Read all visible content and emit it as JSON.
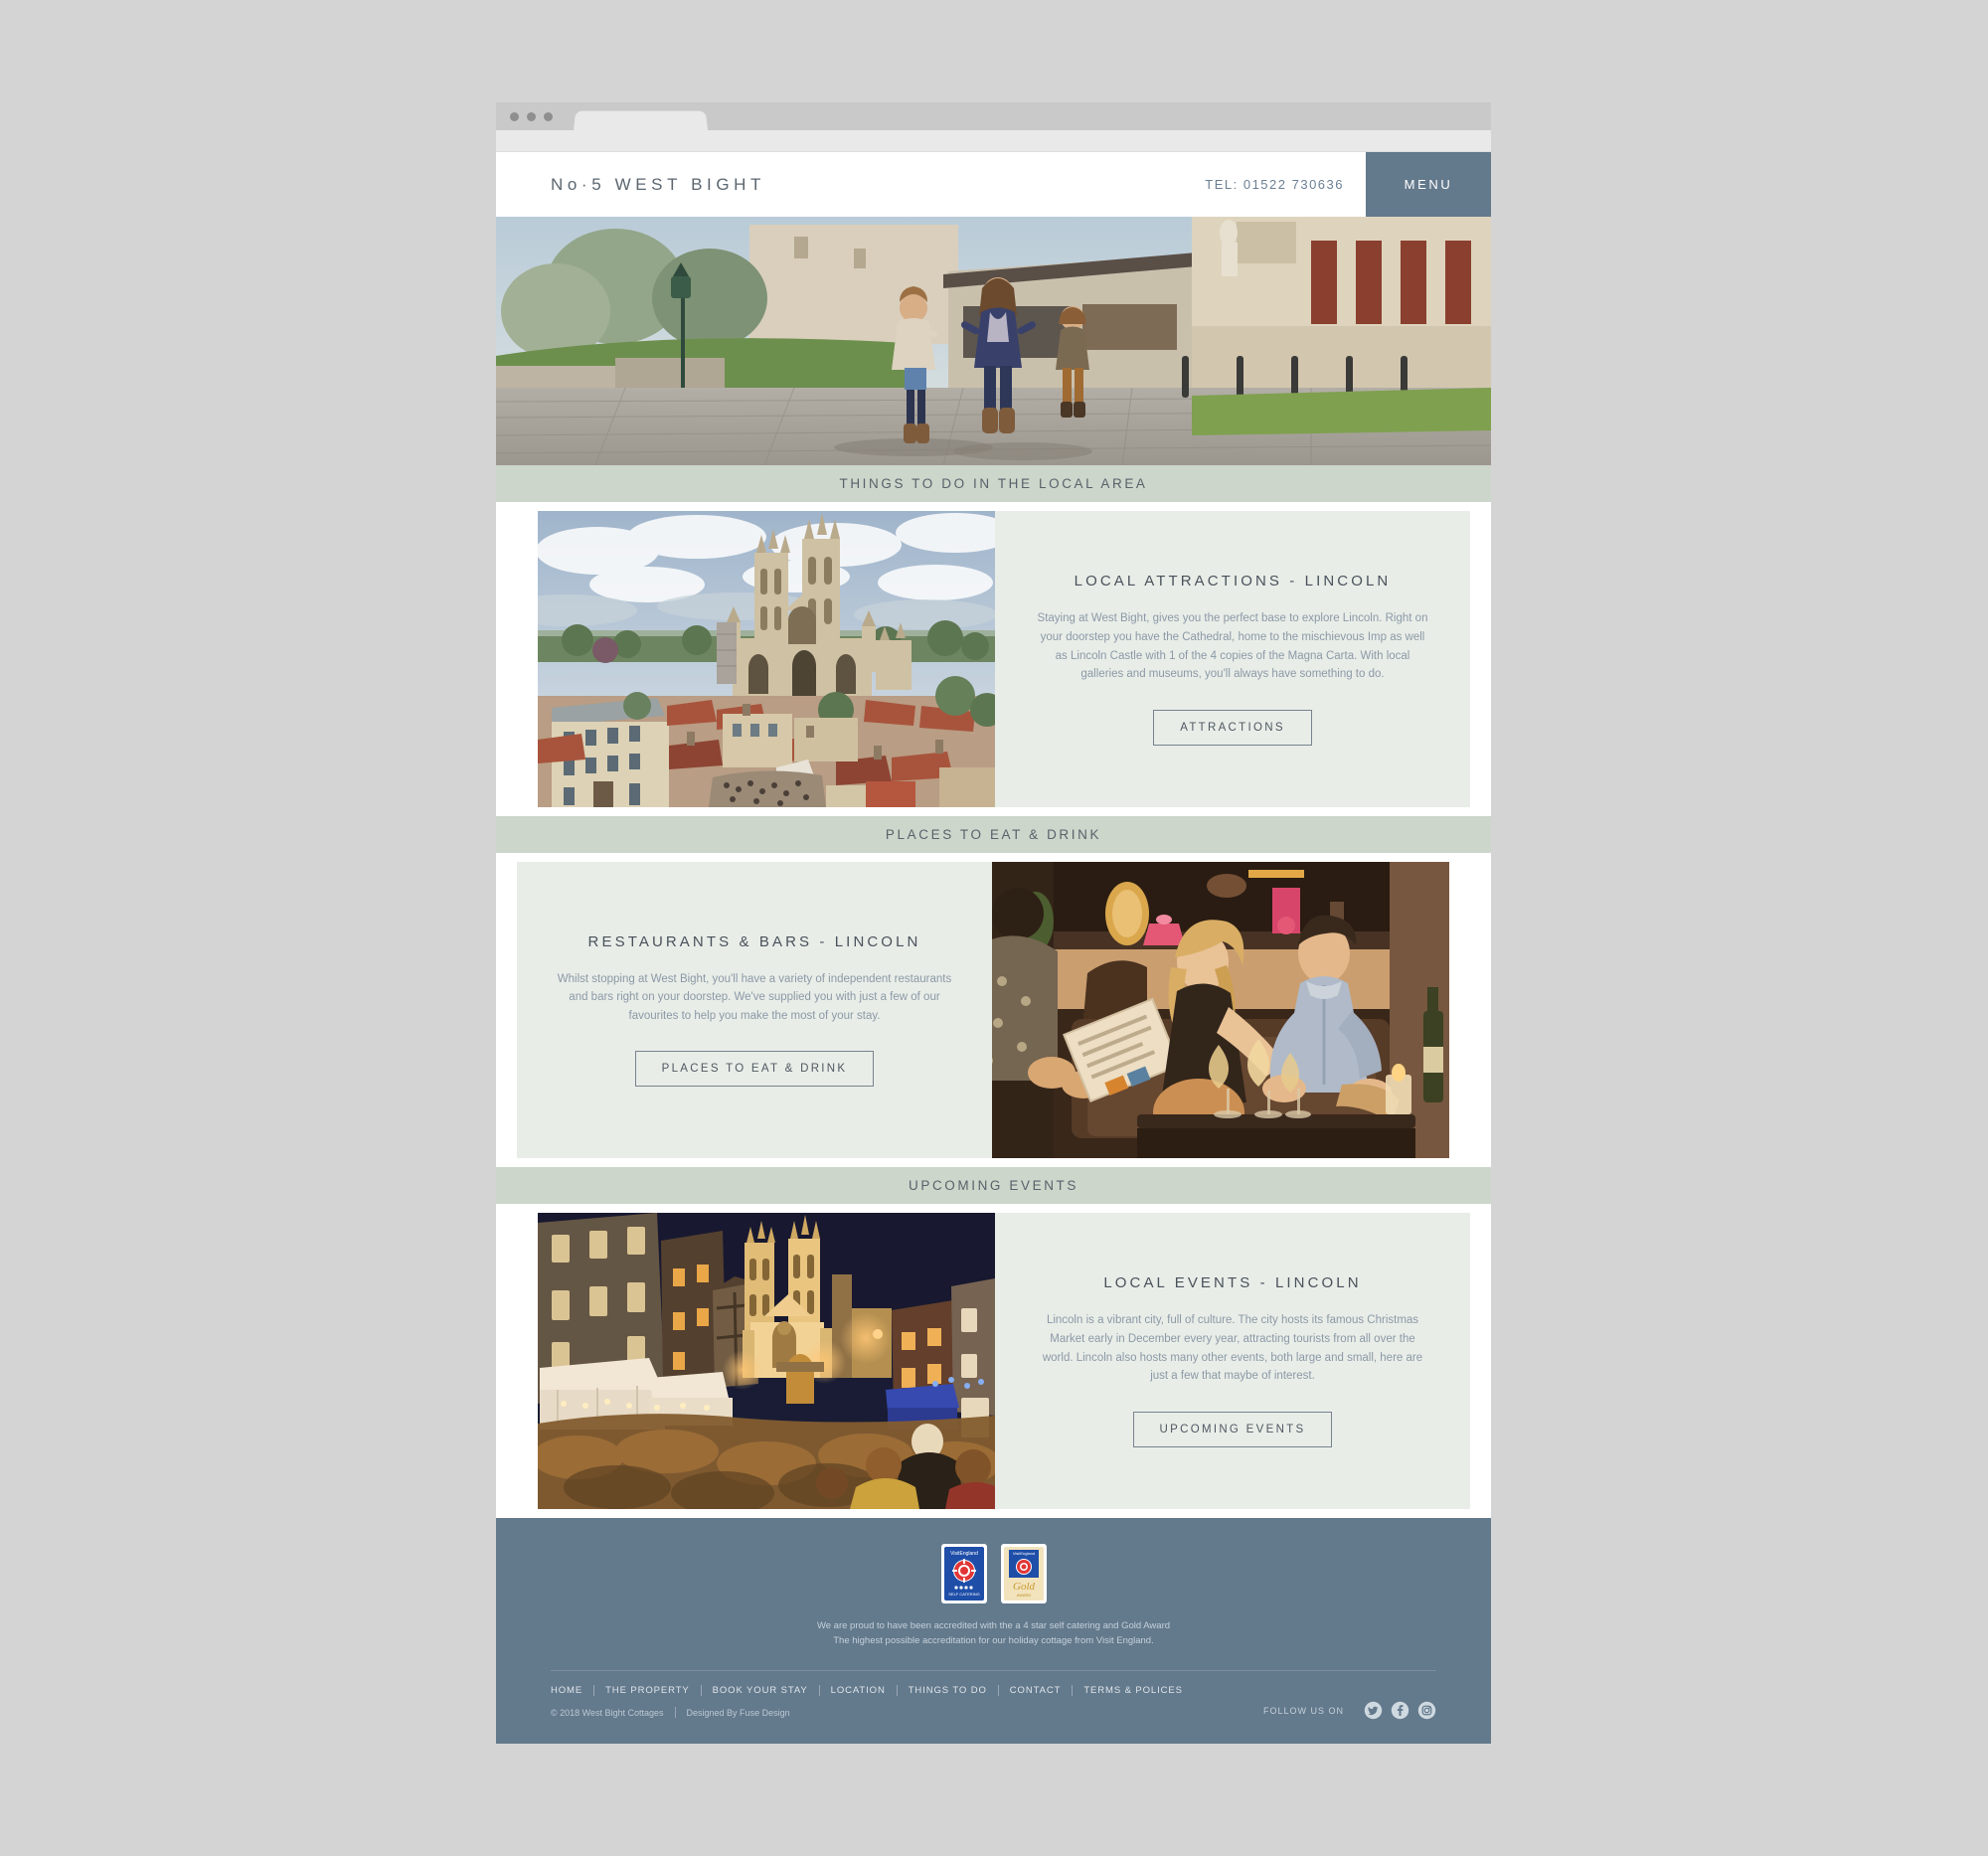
{
  "browser": {
    "window_controls": [
      "close",
      "minimize",
      "maximize"
    ]
  },
  "header": {
    "brand": "No·5 WEST BIGHT",
    "telephone": "TEL: 01522 730636",
    "menu_label": "MENU"
  },
  "hero": {
    "alt": "Family walking hand in hand along a cobbled street past Lincoln Castle"
  },
  "sections": [
    {
      "bar_label": "THINGS TO DO IN THE LOCAL AREA",
      "image_alt": "Aerial view of Lincoln Cathedral above the rooftops of Lincoln",
      "image_side": "left",
      "title": "LOCAL ATTRACTIONS - LINCOLN",
      "body": "Staying at West Bight, gives you the perfect base to explore Lincoln. Right on your doorstep you have the Cathedral, home to the mischievous Imp as well as Lincoln Castle with 1 of the 4 copies of the Magna Carta. With local galleries and museums, you'll always have something to do.",
      "button": "ATTRACTIONS"
    },
    {
      "bar_label": "PLACES TO EAT & DRINK",
      "image_alt": "Couple laughing together over drinks in a warmly lit bar",
      "image_side": "right",
      "title": "RESTAURANTS & BARS - LINCOLN",
      "body": "Whilst stopping at West Bight, you'll have a variety of independent restaurants and bars right on your doorstep. We've supplied you with just a few of our favourites to help you make the most of your stay.",
      "button": "PLACES TO EAT & DRINK"
    },
    {
      "bar_label": "UPCOMING EVENTS",
      "image_alt": "Lincoln Christmas Market at night with the Cathedral floodlit behind the crowds",
      "image_side": "left",
      "title": "LOCAL EVENTS - LINCOLN",
      "body": "Lincoln is a vibrant city, full of culture. The city hosts its famous Christmas Market early in December every year, attracting tourists from all over the world. Lincoln also hosts many other events, both large and small, here are just a few that maybe of interest.",
      "button": "UPCOMING EVENTS"
    }
  ],
  "footer": {
    "badges": [
      {
        "name": "visitengland-self-catering-4-star",
        "brand": "VisitEngland",
        "caption": "SELF CATERING",
        "stars": 4
      },
      {
        "name": "visitengland-gold-award",
        "brand": "VisitEngland",
        "caption": "Gold",
        "sub_caption": "AWARD"
      }
    ],
    "accreditation_line_1": "We are proud to have been accredited with the a 4 star self catering and Gold Award",
    "accreditation_line_2": "The highest possible accreditation for our holiday cottage from Visit England.",
    "links": [
      "HOME",
      "THE PROPERTY",
      "BOOK YOUR STAY",
      "LOCATION",
      "THINGS TO DO",
      "CONTACT",
      "TERMS & POLICES"
    ],
    "copyright": "© 2018 West Bight Cottages",
    "designer": "Designed By Fuse Design",
    "follow_label": "FOLLOW US ON",
    "social": [
      "twitter",
      "facebook",
      "instagram"
    ]
  },
  "colors": {
    "page_background": "#d4d4d4",
    "accent_slate": "#63798c",
    "section_bar_sage": "#ccd6cb",
    "card_panel": "#e9ede8",
    "heading_text": "#49525b",
    "body_text": "#8b99a6"
  }
}
